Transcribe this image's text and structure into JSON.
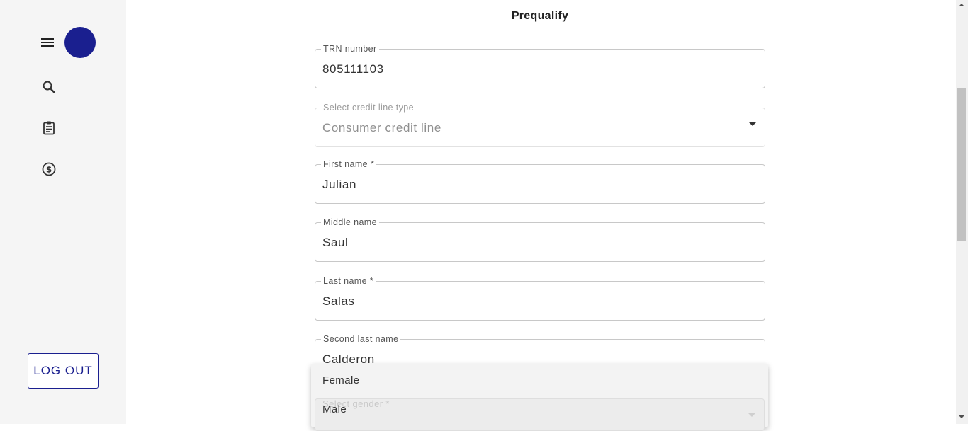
{
  "page": {
    "title": "Prequalify"
  },
  "sidebar": {
    "icons": [
      "menu-icon",
      "search-icon",
      "clipboard-icon",
      "dollar-icon"
    ],
    "avatar_color": "#1a1f8f",
    "logout_label": "LOG OUT"
  },
  "form": {
    "trn": {
      "label": "TRN number",
      "value": "805111103"
    },
    "credit_line": {
      "label": "Select credit line type",
      "value": "Consumer credit line"
    },
    "first_name": {
      "label": "First name *",
      "value": "Julian"
    },
    "middle_name": {
      "label": "Middle name",
      "value": "Saul"
    },
    "last_name": {
      "label": "Last name *",
      "value": "Salas"
    },
    "second_last_name": {
      "label": "Second last name",
      "value": "Calderon"
    },
    "gender": {
      "label": "Select gender *"
    }
  },
  "gender_dropdown": {
    "options": [
      "Female",
      "Male"
    ]
  },
  "colors": {
    "accent": "#1a1f8f",
    "sidebar_bg": "#f5f5f5"
  }
}
